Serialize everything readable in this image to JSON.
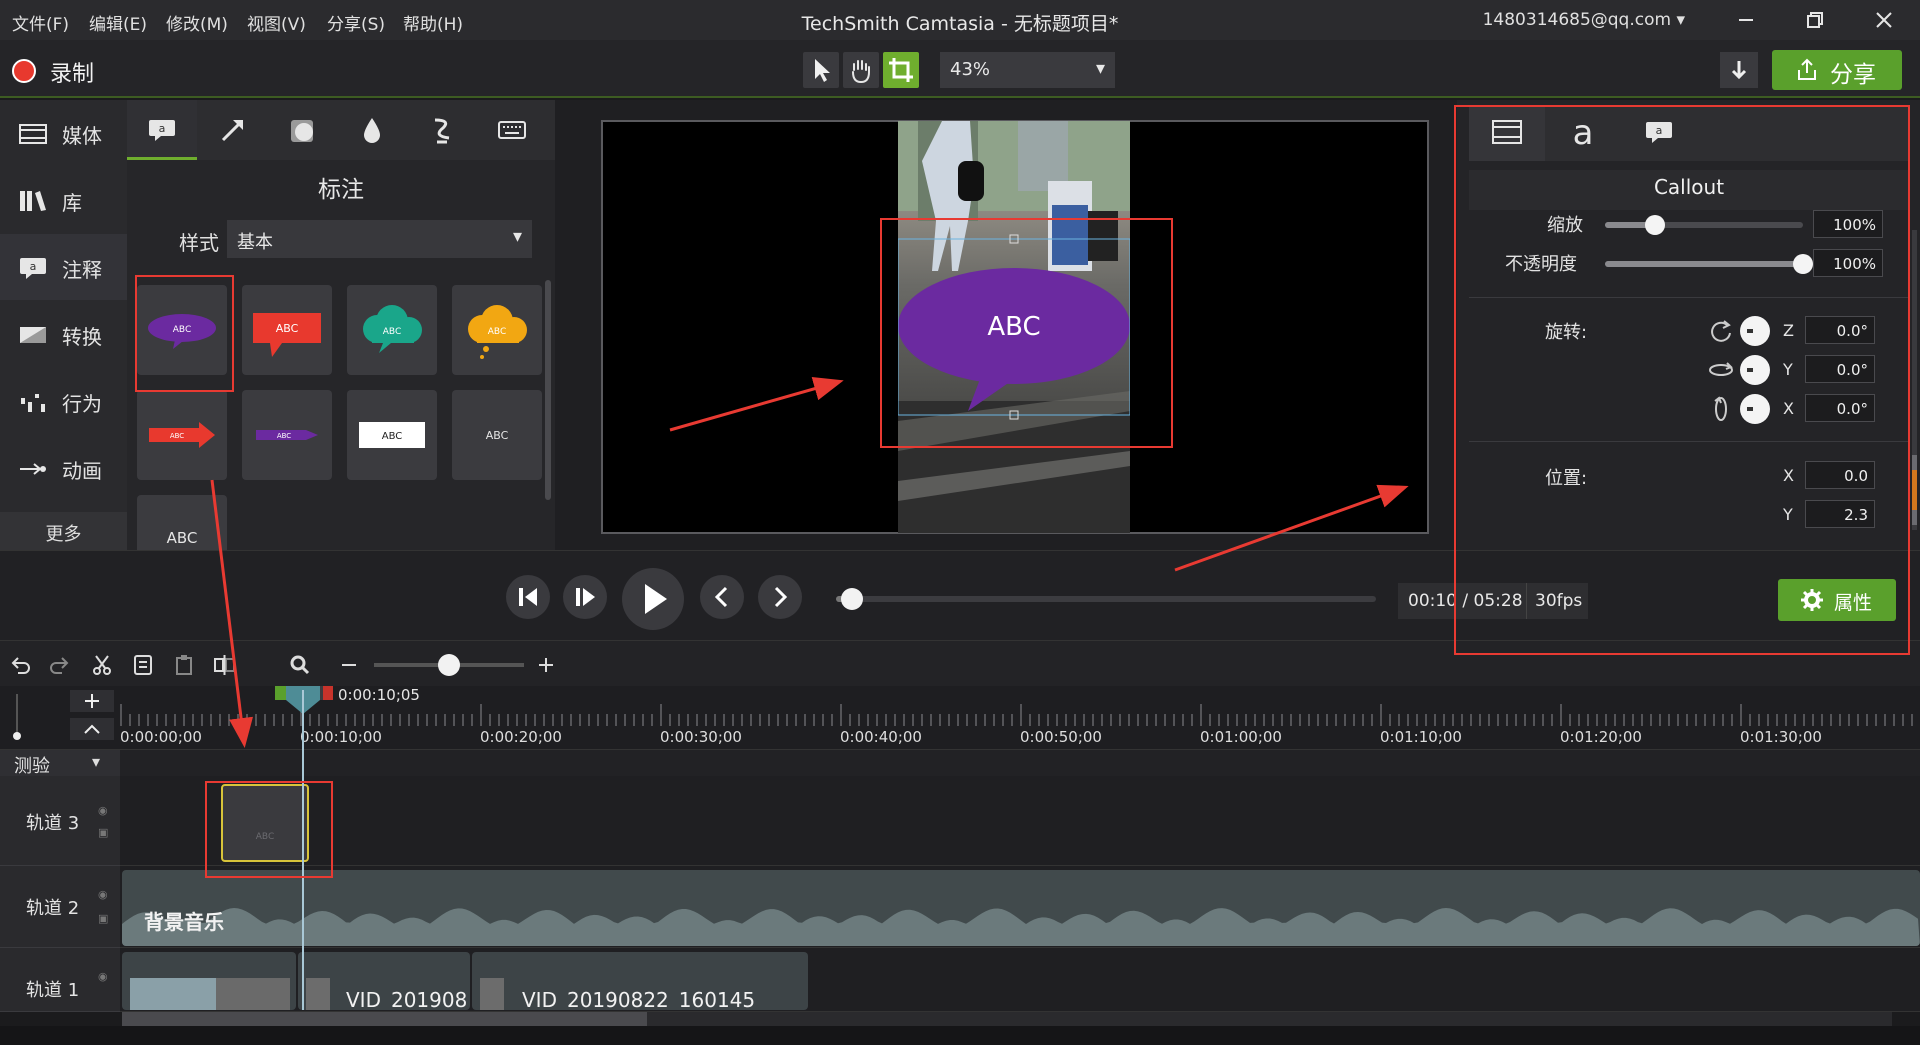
{
  "menu": [
    {
      "label": "文件(F)"
    },
    {
      "label": "编辑(E)"
    },
    {
      "label": "修改(M)"
    },
    {
      "label": "视图(V)"
    },
    {
      "label": "分享(S)"
    },
    {
      "label": "帮助(H)"
    }
  ],
  "window": {
    "title": "TechSmith Camtasia - 无标题项目*",
    "account": "1480314685@qq.com"
  },
  "toolbar": {
    "record_label": "录制",
    "zoom_value": "43%",
    "share_label": "分享",
    "accent_color": "#5aa02c",
    "record_color": "#e8392e"
  },
  "sidebar": {
    "items": [
      {
        "label": "媒体",
        "icon": "film-icon"
      },
      {
        "label": "库",
        "icon": "library-icon"
      },
      {
        "label": "注释",
        "icon": "annotation-icon"
      },
      {
        "label": "转换",
        "icon": "transition-icon"
      },
      {
        "label": "行为",
        "icon": "behavior-icon"
      },
      {
        "label": "动画",
        "icon": "animation-icon"
      }
    ],
    "more_label": "更多"
  },
  "annotations": {
    "title": "标注",
    "style_label": "样式",
    "style_value": "基本",
    "tabs": [
      "callout-icon",
      "arrow-icon",
      "shape-icon",
      "blur-icon",
      "sketch-icon",
      "keystroke-icon"
    ],
    "tiles": [
      {
        "text": "ABC",
        "color": "#6b2aa0"
      },
      {
        "text": "ABC",
        "color": "#e8392e"
      },
      {
        "text": "ABC",
        "color": "#1aa68a"
      },
      {
        "text": "ABC",
        "color": "#f2a712"
      },
      {
        "text": "ABC",
        "color": "#e8392e"
      },
      {
        "text": "ABC",
        "color": "#6b2aa0"
      },
      {
        "text": "ABC",
        "color": "#ffffff"
      },
      {
        "text": "ABC",
        "color": "#3b3b3f"
      },
      {
        "text": "ABC",
        "color": "#3b3b3f"
      }
    ]
  },
  "canvas": {
    "callout_text": "ABC",
    "callout_color": "#6b2aa0"
  },
  "properties": {
    "title": "Callout",
    "scale_label": "缩放",
    "scale_value": "100%",
    "scale_level": 0.25,
    "opacity_label": "不透明度",
    "opacity_value": "100%",
    "opacity_level": 1.0,
    "rotation_label": "旋转:",
    "rotation": [
      {
        "axis": "Z",
        "value": "0.0°"
      },
      {
        "axis": "Y",
        "value": "0.0°"
      },
      {
        "axis": "X",
        "value": "0.0°"
      }
    ],
    "position_label": "位置:",
    "position": [
      {
        "axis": "X",
        "value": "0.0"
      },
      {
        "axis": "Y",
        "value": "2.3"
      }
    ],
    "button_label": "属性"
  },
  "playback": {
    "time": "00:10 / 05:28",
    "fps": "30fps",
    "progress": 0.03
  },
  "timeline": {
    "playhead": "0:00:10;05",
    "ticks": [
      "0:00:00;00",
      "0:00:10;00",
      "0:00:20;00",
      "0:00:30;00",
      "0:00:40;00",
      "0:00:50;00",
      "0:01:00;00",
      "0:01:10;00",
      "0:01:20;00",
      "0:01:30;00"
    ],
    "group_label": "测验",
    "tracks": [
      {
        "name": "轨道 3"
      },
      {
        "name": "轨道 2",
        "clip_label": "背景音乐"
      },
      {
        "name": "轨道 1",
        "clips": [
          "VID_201908",
          "VID_20190822_160145"
        ]
      }
    ],
    "track3_clip_text": "ABC"
  }
}
